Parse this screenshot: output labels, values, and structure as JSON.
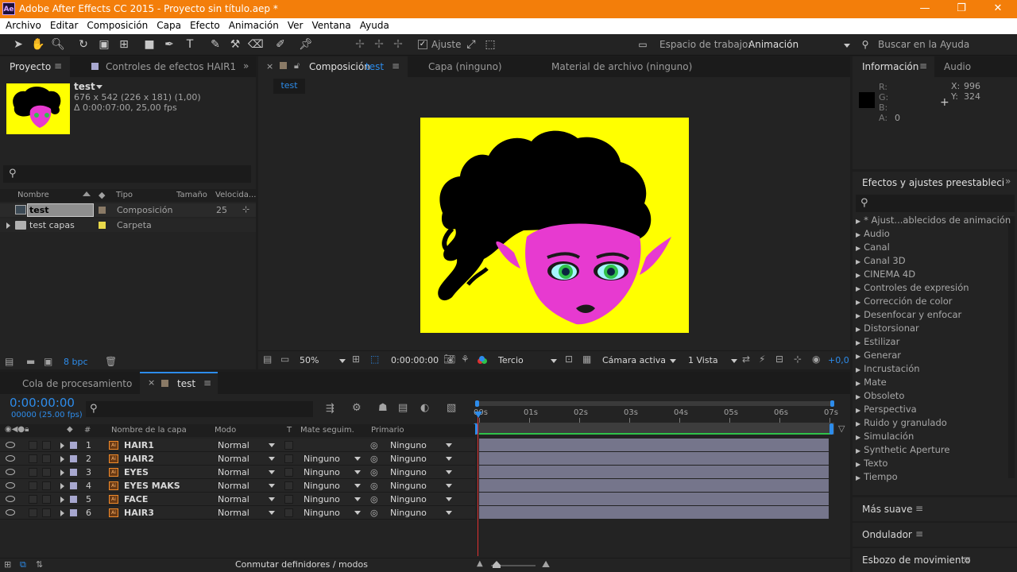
{
  "title_bar": {
    "app_icon": "Ae",
    "title": "Adobe After Effects CC 2015 - Proyecto sin título.aep *",
    "minimize": "—",
    "maximize": "❐",
    "close": "✕"
  },
  "menu": [
    "Archivo",
    "Editar",
    "Composición",
    "Capa",
    "Efecto",
    "Animación",
    "Ver",
    "Ventana",
    "Ayuda"
  ],
  "toolbar": {
    "snap_label": "Ajuste",
    "workspace_label": "Espacio de trabajo:",
    "workspace_value": "Animación",
    "search_help": "Buscar en la Ayuda"
  },
  "project_panel": {
    "tab_project": "Proyecto",
    "tab_effects_controls": "Controles de efectos  HAIR1",
    "item_name": "test",
    "item_dims": "676 x 542  (226 x 181) (1,00)",
    "item_duration": "Δ 0:00:07:00, 25,00 fps",
    "search_icon": "⚲",
    "columns": {
      "name": "Nombre",
      "type": "Tipo",
      "size": "Tamaño",
      "speed": "Velocida..."
    },
    "rows": [
      {
        "name": "test",
        "type": "Composición",
        "size": "25",
        "color": "#8a7a66"
      },
      {
        "name": "test capas",
        "type": "Carpeta",
        "size": "",
        "color": "#e8d84a"
      }
    ],
    "footer_bpc": "8 bpc"
  },
  "comp_panel": {
    "tab_comp_prefix": "Composición",
    "tab_comp_name": "test",
    "tab_layer": "Capa  (ninguno)",
    "tab_footage": "Material de archivo  (ninguno)",
    "breadcrumb": "test",
    "zoom": "50%",
    "timecode": "0:00:00:00",
    "resolution": "Tercio",
    "camera": "Cámara activa",
    "views": "1 Vista",
    "exposure": "+0,0"
  },
  "info_panel": {
    "tab_info": "Información",
    "tab_audio": "Audio",
    "r": "R:",
    "g": "G:",
    "b": "B:",
    "a": "A:",
    "a_value": "0",
    "x": "X:",
    "x_value": "996",
    "y": "Y:",
    "y_value": "324"
  },
  "effects_panel": {
    "title": "Efectos y ajustes preestableci",
    "items": [
      "* Ajust...ablecidos de animación",
      "Audio",
      "Canal",
      "Canal 3D",
      "CINEMA 4D",
      "Controles de expresión",
      "Corrección de color",
      "Desenfocar y enfocar",
      "Distorsionar",
      "Estilizar",
      "Generar",
      "Incrustación",
      "Mate",
      "Obsoleto",
      "Perspectiva",
      "Ruido y granulado",
      "Simulación",
      "Synthetic Aperture",
      "Texto",
      "Tiempo"
    ]
  },
  "side_panels": {
    "smoother": "Más suave",
    "wiggler": "Ondulador",
    "motion_sketch": "Esbozo de movimiento"
  },
  "timeline": {
    "tab_render": "Cola de procesamiento",
    "tab_comp": "test",
    "timecode": "0:00:00:00",
    "frames_fps": "00000 (25.00 fps)",
    "columns": {
      "num": "#",
      "layer_name": "Nombre de la capa",
      "mode": "Modo",
      "t": "T",
      "track_matte": "Mate seguim.",
      "parent": "Primario"
    },
    "ruler": [
      "00s",
      "01s",
      "02s",
      "03s",
      "04s",
      "05s",
      "06s",
      "07s"
    ],
    "layers": [
      {
        "num": "1",
        "name": "HAIR1",
        "mode": "Normal",
        "matte": "",
        "parent": "Ninguno"
      },
      {
        "num": "2",
        "name": "HAIR2",
        "mode": "Normal",
        "matte": "Ninguno",
        "parent": "Ninguno"
      },
      {
        "num": "3",
        "name": "EYES",
        "mode": "Normal",
        "matte": "Ninguno",
        "parent": "Ninguno"
      },
      {
        "num": "4",
        "name": "EYES MAKS",
        "mode": "Normal",
        "matte": "Ninguno",
        "parent": "Ninguno"
      },
      {
        "num": "5",
        "name": "FACE",
        "mode": "Normal",
        "matte": "Ninguno",
        "parent": "Ninguno"
      },
      {
        "num": "6",
        "name": "HAIR3",
        "mode": "Normal",
        "matte": "Ninguno",
        "parent": "Ninguno"
      }
    ],
    "footer_toggle": "Conmutar definidores / modos"
  },
  "colors": {
    "title_bar": "#f37e0a",
    "accent_blue": "#2d8ceb",
    "comp_bg": "#ffff00",
    "layer_bar": "#75758b",
    "playhead": "#e03030"
  }
}
